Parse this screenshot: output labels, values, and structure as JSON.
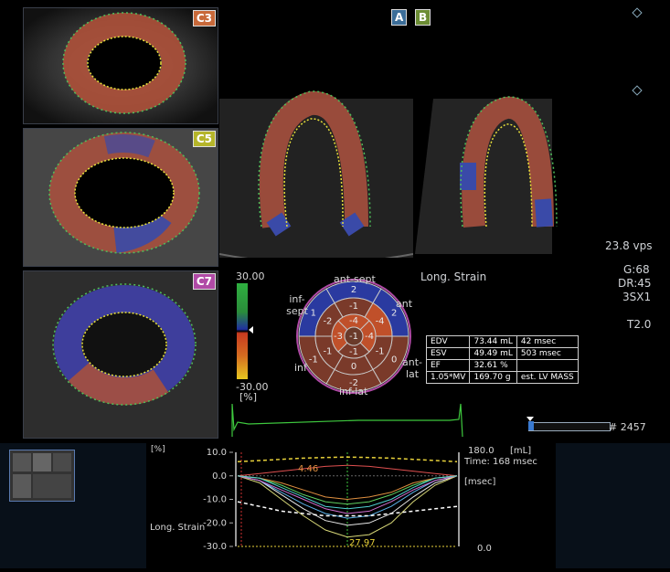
{
  "views": {
    "c3": {
      "label": "C3",
      "color": "#c8693a"
    },
    "c5": {
      "label": "C5",
      "color": "#b5b52a"
    },
    "c7": {
      "label": "C7",
      "color": "#b04aa6"
    },
    "a": {
      "label": "A",
      "color": "#3b6d98"
    },
    "b": {
      "label": "B",
      "color": "#6c8d34"
    }
  },
  "mode_label": "Long. Strain",
  "acquisition": {
    "frame_rate": "23.8 vps",
    "gain": "G:68",
    "dynamic_range": "DR:45",
    "probe": "3SX1",
    "t_setting": "T2.0"
  },
  "color_scale": {
    "max": "30.00",
    "min": "-30.00",
    "unit": "[%]"
  },
  "bullseye": {
    "sectors": {
      "ant_sept": "ant-sept",
      "ant": "ant",
      "ant_lat": "ant-\nlat",
      "inf_lat": "inf-lat",
      "inf": "inf",
      "inf_sept": "inf-\nsept"
    },
    "outer_values": [
      "2",
      "2",
      "0",
      "-2",
      "-1",
      "1"
    ],
    "middle_values": [
      "-1",
      "-4",
      "-1",
      "0",
      "-1",
      "-2"
    ],
    "inner_values": [
      "-4",
      "-4",
      "-1",
      "-3"
    ],
    "center_value": "-1"
  },
  "volume_table": [
    {
      "param": "EDV",
      "value": "73.44 mL",
      "extra": "42 msec"
    },
    {
      "param": "ESV",
      "value": "49.49 mL",
      "extra": "503 msec"
    },
    {
      "param": "EF",
      "value": "32.61 %",
      "extra": ""
    },
    {
      "param": "1.05*MV",
      "value": "169.70 g",
      "extra": "est. LV MASS"
    }
  ],
  "frame_counter": "# 2457",
  "chart": {
    "ylabel_unit": "[%]",
    "mode_label": "Long. Strain",
    "y_ticks": [
      "10.0",
      "0.0",
      "-10.0",
      "-20.0",
      "-30.0"
    ],
    "right_top": "180.0",
    "right_unit": "[mL]",
    "time_label": "Time: 168 msec",
    "msec_unit": "[msec]",
    "right_bottom": "0.0",
    "peak_label_top": "4.46",
    "peak_label_bottom": "27.97"
  },
  "chart_data": {
    "type": "line",
    "ylabel": "",
    "ylim": [
      -30,
      10
    ],
    "y_ticks": [
      10.0,
      0.0,
      -10.0,
      -20.0,
      -30.0
    ],
    "x": [
      0,
      1,
      2,
      3,
      4,
      5,
      6,
      7,
      8,
      9,
      10
    ],
    "series": [
      {
        "color": "#e8e8e8",
        "values": [
          0,
          -2,
          -8,
          -14,
          -19,
          -21,
          -20,
          -16,
          -9,
          -3,
          0
        ]
      },
      {
        "color": "#d8d878",
        "values": [
          0,
          -3,
          -10,
          -17,
          -23,
          -26,
          -25,
          -20,
          -11,
          -4,
          0
        ]
      },
      {
        "color": "#e05050",
        "values": [
          0,
          1,
          2,
          3,
          4,
          4.5,
          4,
          3,
          2,
          1,
          0
        ]
      },
      {
        "color": "#5bb0e8",
        "values": [
          0,
          -2,
          -7,
          -12,
          -16,
          -18,
          -17,
          -13,
          -7,
          -2,
          0
        ]
      },
      {
        "color": "#60d060",
        "values": [
          0,
          -1,
          -4,
          -8,
          -11,
          -12,
          -11,
          -8,
          -4,
          -1,
          0
        ]
      },
      {
        "color": "#d070d0",
        "values": [
          0,
          -2,
          -6,
          -10,
          -14,
          -16,
          -15,
          -11,
          -6,
          -2,
          0
        ]
      },
      {
        "color": "#e09040",
        "values": [
          0,
          -1,
          -3,
          -6,
          -9,
          -10,
          -9,
          -7,
          -3,
          -1,
          0
        ]
      },
      {
        "color": "#50d0d0",
        "values": [
          0,
          -1,
          -5,
          -9,
          -13,
          -14,
          -13,
          -10,
          -5,
          -1,
          0
        ]
      },
      {
        "color": "#ffffff",
        "dashed": true,
        "values": [
          -11,
          -13,
          -15,
          -16,
          -17,
          -17,
          -17,
          -16,
          -15,
          -14,
          -13
        ]
      },
      {
        "color": "#e8d23a",
        "dashed": true,
        "values": [
          6,
          6.5,
          7,
          7.5,
          7.8,
          8,
          7.8,
          7.5,
          7,
          6.5,
          6
        ]
      }
    ]
  }
}
